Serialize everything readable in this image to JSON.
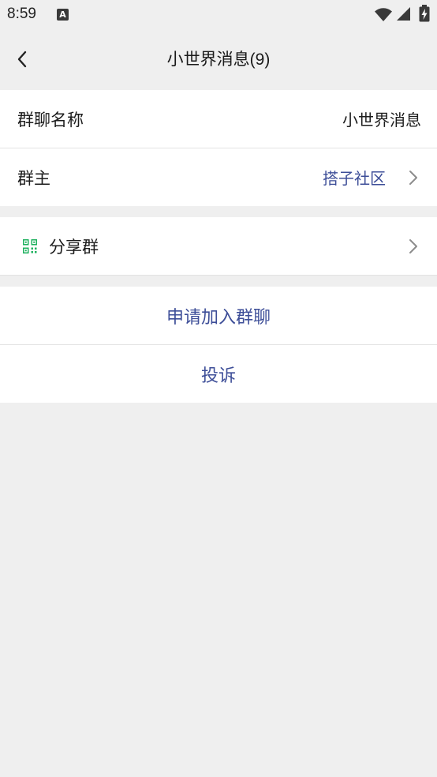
{
  "status_bar": {
    "time": "8:59",
    "notification_letter": "A",
    "icons": [
      "a-notification-icon",
      "wifi-icon",
      "cell-signal-icon",
      "battery-charging-icon"
    ]
  },
  "header": {
    "back_icon": "back-arrow-icon",
    "title": "小世界消息(9)"
  },
  "group_info": {
    "name_label": "群聊名称",
    "name_value": "小世界消息",
    "owner_label": "群主",
    "owner_value": "搭子社区",
    "owner_chevron_icon": "chevron-right-icon"
  },
  "share": {
    "icon": "qr-code-icon",
    "label": "分享群",
    "chevron_icon": "chevron-right-icon"
  },
  "actions": {
    "join_label": "申请加入群聊",
    "report_label": "投诉"
  },
  "colors": {
    "page_background": "#efefef",
    "card_background": "#ffffff",
    "text_primary": "#1c1c1c",
    "link_blue": "#3d4e98",
    "chevron_gray": "#8c8c8c",
    "qr_green": "#1fb15f",
    "divider": "#e3e3e3"
  }
}
